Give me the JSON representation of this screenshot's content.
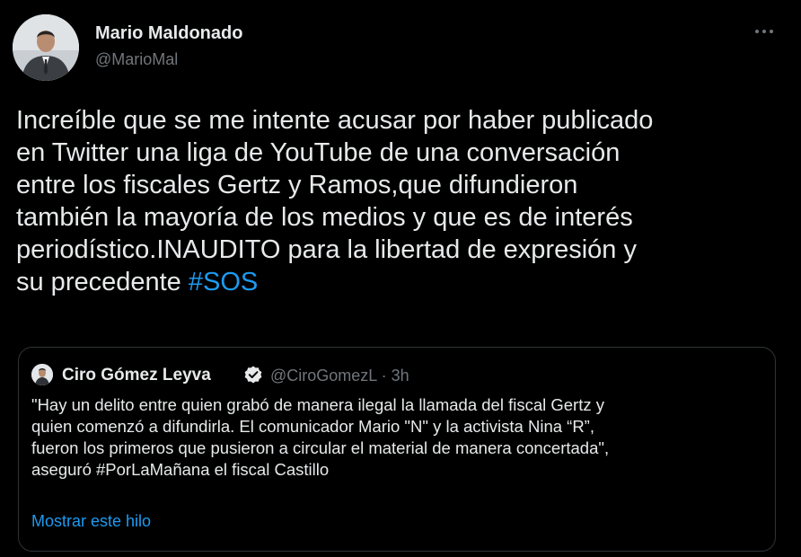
{
  "tweet": {
    "author": {
      "name": "Mario Maldonado",
      "handle": "@MarioMal"
    },
    "more_icon": "more-horizontal-icon",
    "text_lines": [
      "Increíble que se me intente acusar por haber publicado",
      "en Twitter una liga de YouTube de una conversación",
      "entre los fiscales Gertz y Ramos,que difundieron",
      "también la mayoría de los medios y que es de interés",
      "periodístico.INAUDITO para la libertad de expresión y",
      "su precedente "
    ],
    "hashtag": "#SOS"
  },
  "quoted_tweet": {
    "author": {
      "name": "Ciro Gómez Leyva",
      "verified_icon": "verified-badge-icon",
      "handle": "@CiroGomezL",
      "separator": "·",
      "time": "3h"
    },
    "text_lines": [
      "\"Hay un delito entre quien grabó de manera ilegal la llamada del fiscal Gertz y",
      "quien comenzó a difundirla. El comunicador Mario \"N\" y la activista Nina “R”,",
      "fueron los primeros que pusieron a circular el material de manera concertada\",",
      "aseguró #PorLaMañana el fiscal Castillo"
    ],
    "show_thread_label": "Mostrar este hilo"
  },
  "colors": {
    "background": "#000000",
    "text": "#e7e9ea",
    "secondary": "#71767b",
    "link": "#1d9bf0",
    "border": "#2f3336"
  }
}
